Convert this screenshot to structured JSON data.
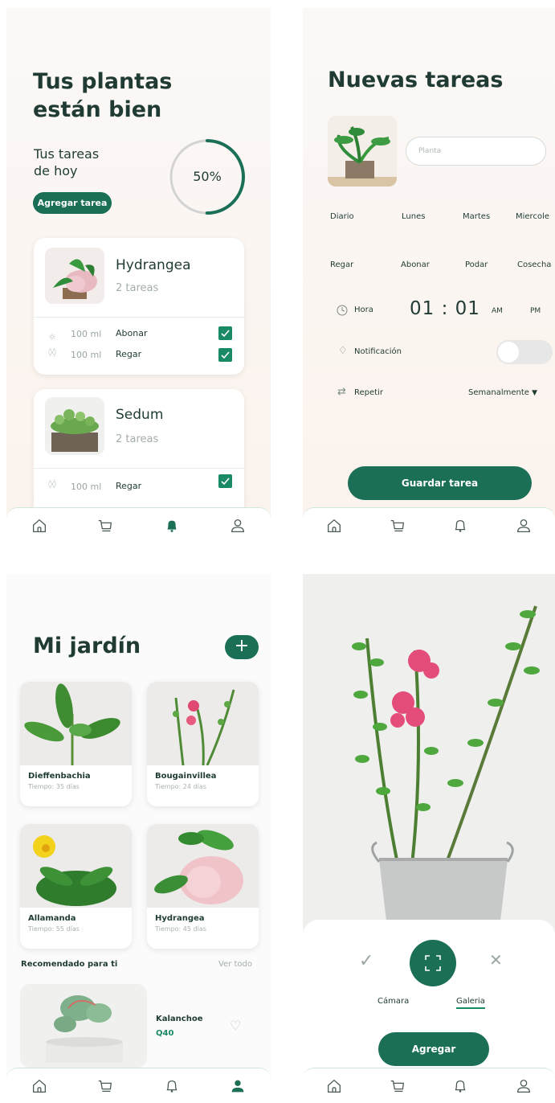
{
  "colors": {
    "primary": "#1a6f56",
    "accent_light": "#d7ece3",
    "text_dark": "#1f3b33",
    "muted": "#9aa6a2"
  },
  "nav_icons": [
    "home-icon",
    "cart-icon",
    "bell-icon",
    "user-icon"
  ],
  "screen_home": {
    "title_line1": "Tus plantas",
    "title_line2": "están bien",
    "tasks_line1": "Tus tareas",
    "tasks_line2": "de hoy",
    "progress_label": "50%",
    "progress_value": 0.5,
    "add_task_label": "Agregar tarea",
    "plants": [
      {
        "name": "Hydrangea",
        "task_count": "2 tareas",
        "tasks": [
          {
            "amount": "100 ml",
            "label": "Abonar",
            "done": true,
            "icon": "sun-icon"
          },
          {
            "amount": "100 ml",
            "label": "Regar",
            "done": true,
            "icon": "drops-icon"
          }
        ]
      },
      {
        "name": "Sedum",
        "task_count": "2 tareas",
        "tasks": [
          {
            "amount": "100 ml",
            "label": "Regar",
            "done": true,
            "icon": "drops-icon"
          }
        ]
      }
    ]
  },
  "screen_new_task": {
    "title": "Nuevas tareas",
    "plant_placeholder": "Planta",
    "frequency": [
      "Diario",
      "Lunes",
      "Martes",
      "Miercole"
    ],
    "actions": [
      "Regar",
      "Abonar",
      "Podar",
      "Cosecha"
    ],
    "time_label": "Hora",
    "time_value": "01 : 01",
    "am": "AM",
    "pm": "PM",
    "notification_label": "Notificación",
    "notification_on": false,
    "repeat_label": "Repetir",
    "repeat_value": "Semanalmente",
    "save_label": "Guardar tarea"
  },
  "screen_garden": {
    "title": "Mi jardín",
    "plants": [
      {
        "name": "Dieffenbachia",
        "time": "Tiempo: 35 días"
      },
      {
        "name": "Bougainvillea",
        "time": "Tiempo: 24 días"
      },
      {
        "name": "Allamanda",
        "time": "Tiempo: 55 días"
      },
      {
        "name": "Hydrangea",
        "time": "Tiempo: 45 días"
      }
    ],
    "recommended_title": "Recomendado para ti",
    "see_all": "Ver todo",
    "recommended": {
      "name": "Kalanchoe",
      "price": "Q40"
    }
  },
  "screen_camera": {
    "camera_label": "Cámara",
    "gallery_label": "Galeria",
    "add_label": "Agregar"
  }
}
